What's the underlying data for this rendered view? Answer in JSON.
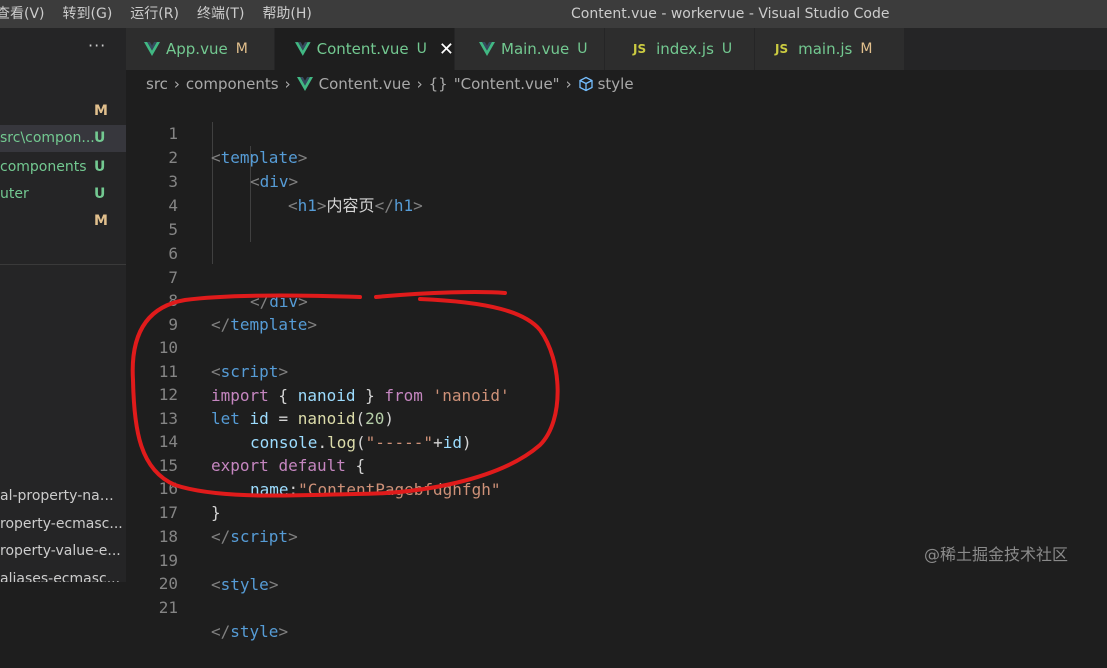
{
  "titlebar": {
    "menu": [
      "查看(V)",
      "转到(G)",
      "运行(R)",
      "终端(T)",
      "帮助(H)"
    ],
    "window_title": "Content.vue - workervue - Visual Studio Code"
  },
  "sidebar": {
    "more_label": "···",
    "files": [
      {
        "name": "",
        "badge": "M"
      },
      {
        "name": "src\\compon...",
        "badge": "U"
      },
      {
        "name": "components",
        "badge": "U"
      },
      {
        "name": "uter",
        "badge": "U"
      },
      {
        "name": "",
        "badge": "M"
      }
    ],
    "outline": [
      "al-property-nam...",
      "roperty-ecmasc...",
      "roperty-value-e...",
      "aliases-ecmasc..."
    ]
  },
  "tabs": [
    {
      "label": "App.vue",
      "badge": "M",
      "icon": "vue-icon"
    },
    {
      "label": "Content.vue",
      "badge": "U",
      "icon": "vue-icon",
      "close": "✕"
    },
    {
      "label": "Main.vue",
      "badge": "U",
      "icon": "vue-icon"
    },
    {
      "label": "index.js",
      "badge": "U",
      "icon": "js-icon",
      "icon_text": "JS"
    },
    {
      "label": "main.js",
      "badge": "M",
      "icon": "js-icon",
      "icon_text": "JS"
    }
  ],
  "breadcrumb": {
    "src": "src",
    "components": "components",
    "file": "Content.vue",
    "braces": "{}",
    "component": "\"Content.vue\"",
    "style": "style"
  },
  "editor": {
    "line_numbers": [
      "1",
      "2",
      "3",
      "4",
      "5",
      "6",
      "7",
      "8",
      "9",
      "10",
      "11",
      "12",
      "13",
      "14",
      "15",
      "16",
      "17",
      "18",
      "19",
      "20",
      "21"
    ],
    "code": {
      "l1_open": "<",
      "l1_tag": "template",
      "l1_close": ">",
      "l2_open": "<",
      "l2_tag": "div",
      "l2_close": ">",
      "l3_open": "<",
      "l3_tag": "h1",
      "l3_close": ">",
      "l3_text": "内容页",
      "l3_end_open": "</",
      "l3_end_tag": "h1",
      "l3_end_close": ">",
      "l7_open": "</",
      "l7_tag": "div",
      "l7_close": ">",
      "l8_open": "</",
      "l8_tag": "template",
      "l8_close": ">",
      "l10_open": "<",
      "l10_tag": "script",
      "l10_close": ">",
      "l11_import": "import",
      "l11_brace_open": " { ",
      "l11_ident": "nanoid",
      "l11_brace_close": " } ",
      "l11_from": "from",
      "l11_str": "'nanoid'",
      "l12_let": "let",
      "l12_var": "id",
      "l12_eq": " = ",
      "l12_fn": "nanoid",
      "l12_paren_open": "(",
      "l12_num": "20",
      "l12_paren_close": ")",
      "l13_obj": "console",
      "l13_dot": ".",
      "l13_fn": "log",
      "l13_paren_open": "(",
      "l13_str": "\"-----\"",
      "l13_plus": "+",
      "l13_var": "id",
      "l13_paren_close": ")",
      "l14_export": "export",
      "l14_default": "default",
      "l14_brace": " {",
      "l15_key": "name",
      "l15_colon": ":",
      "l15_str": "\"ContentPagebfdghfgh\"",
      "l16_brace": "}",
      "l17_open": "</",
      "l17_tag": "script",
      "l17_close": ">",
      "l19_open": "<",
      "l19_tag": "style",
      "l19_close": ">",
      "l21_open": "</",
      "l21_tag": "style",
      "l21_close": ">"
    }
  },
  "watermark": "@稀土掘金技术社区",
  "colors": {
    "accent_annotation": "#e01b1b",
    "modified": "#e2c08d",
    "untracked": "#73c991",
    "tag": "#569cd6",
    "keyword": "#c586c0",
    "string": "#ce9178"
  }
}
